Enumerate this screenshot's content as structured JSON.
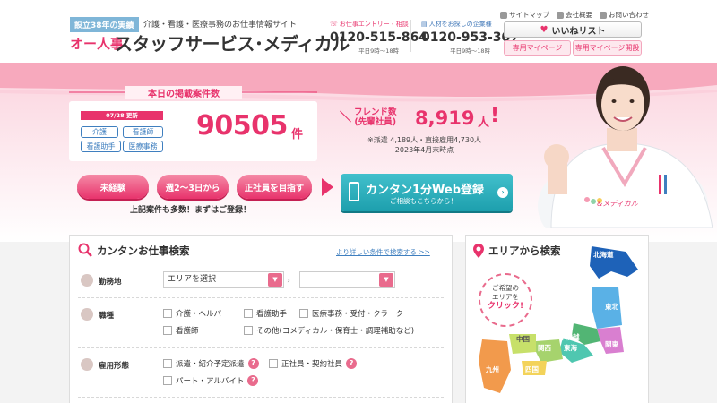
{
  "header": {
    "badge": "設立38年の実績",
    "tagline": "介護・看護・医療事務のお仕事情報サイト",
    "logo_small": "オー人事",
    "logo_main": "スタッフサービス･メディカル",
    "phone1": {
      "label": "お仕事エントリー・相談",
      "number": "0120-515-864",
      "hours": "平日9時～18時"
    },
    "phone2": {
      "label": "人材をお探しの企業様",
      "number": "0120-953-307",
      "hours": "平日9時～18時"
    },
    "toplinks": [
      "サイトマップ",
      "会社概要",
      "お問い合わせ"
    ],
    "favorite_label": "いいねリスト",
    "mypage_label": "専用マイページ",
    "mypage_open_label": "専用マイページ開設"
  },
  "counts": {
    "title": "本日の掲載案件数",
    "date_tag": "07/28 更新",
    "categories": [
      "介護",
      "看護師",
      "看護助手",
      "医療事務"
    ],
    "number": "90505",
    "unit": "件"
  },
  "friends": {
    "label_line1": "フレンド数",
    "label_line2": "(先輩社員)",
    "number": "8,919",
    "unit": "人",
    "bang": "!",
    "slash": "＼",
    "note_line1": "※派遣 4,189人・直接雇用4,730人",
    "note_line2": "2023年4月末時点"
  },
  "cta": {
    "pills": [
      "未経験",
      "週2～3日から",
      "正社員を目指す"
    ],
    "note": "上記案件も多数！まずはご登録！",
    "web_main": "カンタン1分Web登録",
    "web_sub": "ご相談もこちらから！",
    "go": "›"
  },
  "model": {
    "brand": "&メディカル"
  },
  "search": {
    "title": "カンタンお仕事検索",
    "advanced_link": "より詳しい条件で検索する >>",
    "location_label": "勤務地",
    "area_select": "エリアを選択",
    "area_select2": "",
    "arrow": "›",
    "dropdown_glyph": "▼",
    "job_label": "職種",
    "jobs": [
      "介護・ヘルパー",
      "看護助手",
      "医療事務・受付・クラーク",
      "看護師",
      "その他(コメディカル・保育士・調理補助など)"
    ],
    "employ_label": "雇用形態",
    "employ": [
      "派遣・紹介予定派遣",
      "正社員・契約社員",
      "パート・アルバイト"
    ],
    "help_glyph": "?"
  },
  "area": {
    "title": "エリアから検索",
    "bubble_line1": "ご希望の",
    "bubble_line2": "エリアを",
    "bubble_click": "クリック!",
    "regions": [
      "北海道",
      "東北",
      "関東",
      "甲信越",
      "東海",
      "中国",
      "関西",
      "四国",
      "九州"
    ]
  },
  "colors": {
    "brand_pink": "#e8336c",
    "teal": "#1d9fad",
    "blue": "#3f7fbf"
  }
}
